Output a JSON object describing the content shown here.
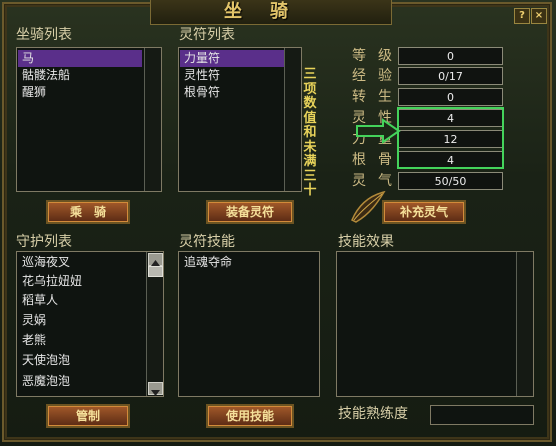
{
  "window": {
    "title": "坐骑"
  },
  "top_buttons": {
    "help": "?",
    "close": "×"
  },
  "mount_list": {
    "title": "坐骑列表",
    "items": [
      "马",
      "骷髅法船",
      "醒狮"
    ],
    "selected_index": 0
  },
  "talisman_list": {
    "title": "灵符列表",
    "items": [
      "力量符",
      "灵性符",
      "根骨符"
    ],
    "selected_index": 0
  },
  "note": {
    "text": "三项数值和未满三十"
  },
  "stats": [
    {
      "label": "等级",
      "value": "0"
    },
    {
      "label": "经验",
      "value": "0/17"
    },
    {
      "label": "转生",
      "value": "0"
    },
    {
      "label": "灵性",
      "value": "4"
    },
    {
      "label": "力量",
      "value": "12"
    },
    {
      "label": "根骨",
      "value": "4"
    },
    {
      "label": "灵气",
      "value": "50/50"
    }
  ],
  "buttons": {
    "ride": "乘　骑",
    "equip_talisman": "装备灵符",
    "refill_spirit": "补充灵气",
    "manage": "管制",
    "use_skill": "使用技能"
  },
  "guard_list": {
    "title": "守护列表",
    "items": [
      "巡海夜叉",
      "花乌拉妞妞",
      "稻草人",
      "灵娲",
      "老熊",
      "天使泡泡",
      "恶魔泡泡"
    ]
  },
  "talisman_skill": {
    "title": "灵符技能",
    "items": [
      "追魂夺命"
    ]
  },
  "skill_effect": {
    "title": "技能效果"
  },
  "skill_proficiency": {
    "label": "技能熟练度",
    "value": ""
  },
  "colors": {
    "highlight": "#44d35b",
    "selection": "#5a2f8a",
    "accent": "#e8d35a"
  }
}
